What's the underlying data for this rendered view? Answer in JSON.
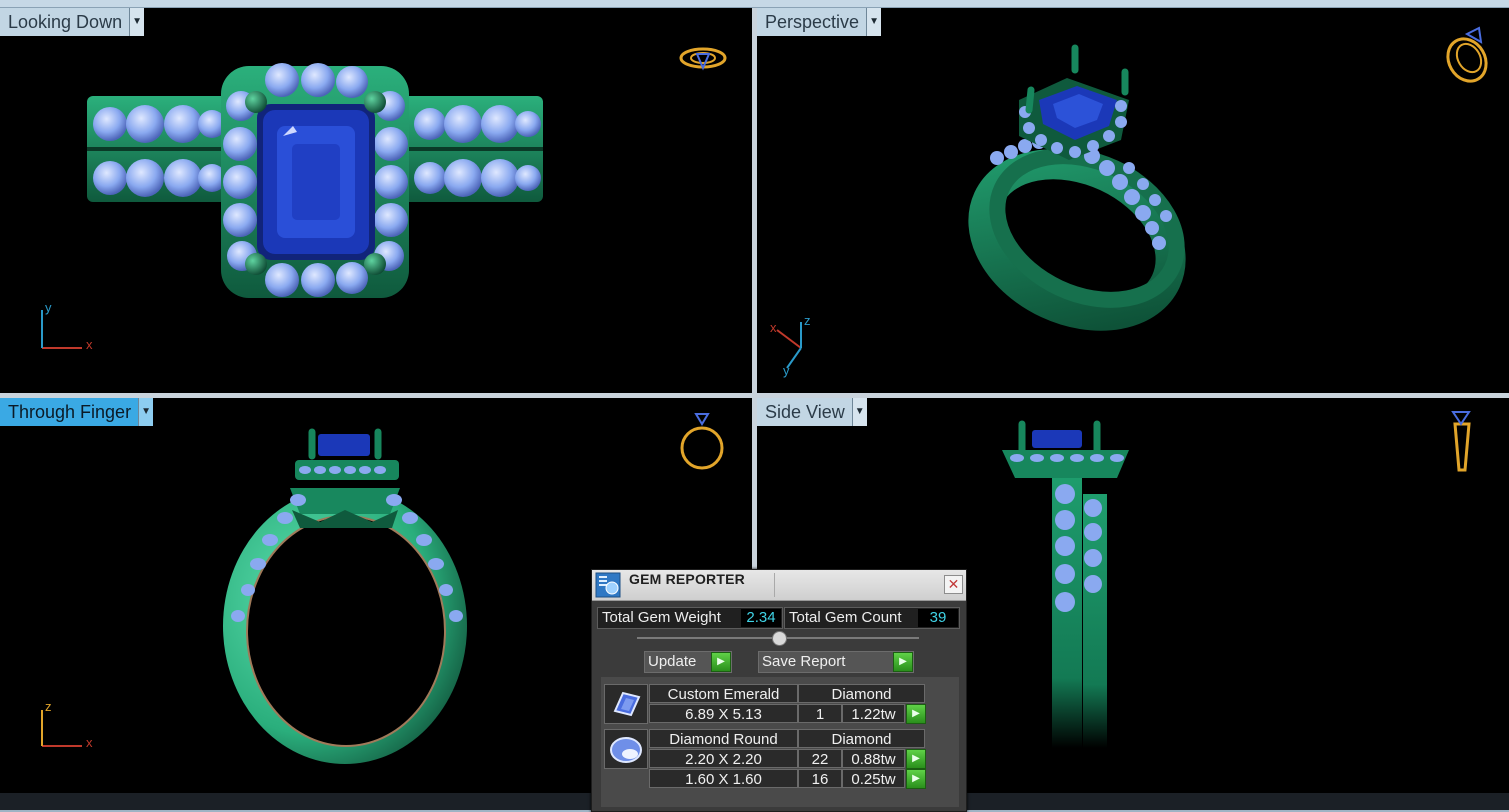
{
  "viewports": {
    "top_left": {
      "label": "Looking Down",
      "active": false
    },
    "top_right": {
      "label": "Perspective",
      "active": false
    },
    "bottom_left": {
      "label": "Through Finger",
      "active": true
    },
    "bottom_right": {
      "label": "Side View",
      "active": false
    }
  },
  "axes": {
    "x": "x",
    "y": "y",
    "z": "z"
  },
  "gem_reporter": {
    "title": "GEM REPORTER",
    "close_glyph": "✕",
    "total_weight_label": "Total Gem Weight",
    "total_weight_value": "2.34",
    "total_count_label": "Total Gem Count",
    "total_count_value": "39",
    "update_label": "Update",
    "save_report_label": "Save Report",
    "groups": [
      {
        "shape": "Custom Emerald",
        "material": "Diamond",
        "icon": "emerald-cut-gem-icon",
        "rows": [
          {
            "size": "6.89 X 5.13",
            "count": "1",
            "weight": "1.22tw"
          }
        ]
      },
      {
        "shape": "Diamond Round",
        "material": "Diamond",
        "icon": "round-gem-icon",
        "rows": [
          {
            "size": "2.20 X 2.20",
            "count": "22",
            "weight": "0.88tw"
          },
          {
            "size": "1.60 X 1.60",
            "count": "16",
            "weight": "0.25tw"
          }
        ]
      }
    ]
  },
  "colors": {
    "metal": "#1f8a5f",
    "center_stone": "#1b38b8",
    "accent_stones": "#8aa9f0",
    "navigator": "#e2a52a",
    "active_label": "#3aa9e4"
  }
}
